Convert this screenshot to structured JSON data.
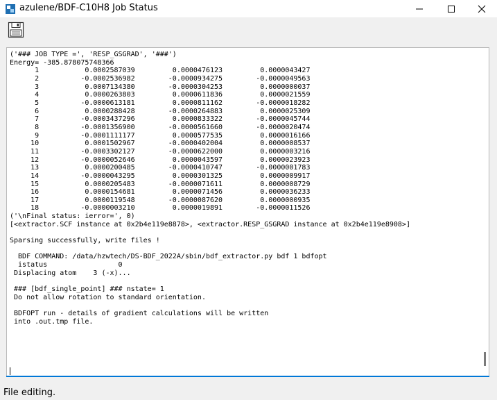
{
  "window": {
    "title": "azulene/BDF-C10H8 Job Status",
    "icon": "app-icon",
    "controls": [
      "minimize-icon",
      "maximize-icon",
      "close-icon"
    ]
  },
  "toolbar": {
    "save_icon": "floppy-disk-icon"
  },
  "log": {
    "text": "('### JOB TYPE =', 'RESP_GSGRAD', '###')\nEnergy= -385.878075748366\n      1           0.0002587039         0.0000476123         0.0000043427\n      2          -0.0002536982        -0.0000934275        -0.0000049563\n      3           0.0007134380        -0.0000304253         0.0000000037\n      4           0.0000263803         0.0000611836         0.0000021559\n      5          -0.0000613181         0.0000811162        -0.0000018282\n      6           0.0000288428        -0.0000264883         0.0000025309\n      7          -0.0003437296         0.0000833322        -0.0000045744\n      8          -0.0001356900        -0.0000561660        -0.0000020474\n      9          -0.0001111177         0.0000577535         0.0000016166\n     10           0.0001502967        -0.0000402004         0.0000008537\n     11          -0.0003302127        -0.0000622000         0.0000003216\n     12          -0.0000052646         0.0000043597         0.0000023923\n     13           0.0000200485        -0.0000410747        -0.0000001783\n     14          -0.0000043295         0.0000301325         0.0000009917\n     15           0.0000205483        -0.0000071611         0.0000008729\n     16           0.0000154681         0.0000071456         0.0000036233\n     17           0.0000119548        -0.0000087620         0.0000000935\n     18          -0.0000003210         0.0000019891        -0.0000011526\n('\\nFinal status: ierror=', 0)\n[<extractor.SCF instance at 0x2b4e119e8878>, <extractor.RESP_GSGRAD instance at 0x2b4e119e8908>]\n\nSparsing successfully, write files !\n\n  BDF COMMAND: /data/hzwtech/DS-BDF_2022A/sbin/bdf_extractor.py bdf 1 bdfopt\n  istatus                 0\n Displacing atom    3 (-x)...\n\n ### [bdf_single_point] ### nstate= 1\n Do not allow rotation to standard orientation.\n\n BDFOPT run - details of gradient calculations will be written\n into .out.tmp file.\n"
  },
  "status": {
    "text": "File editing."
  }
}
